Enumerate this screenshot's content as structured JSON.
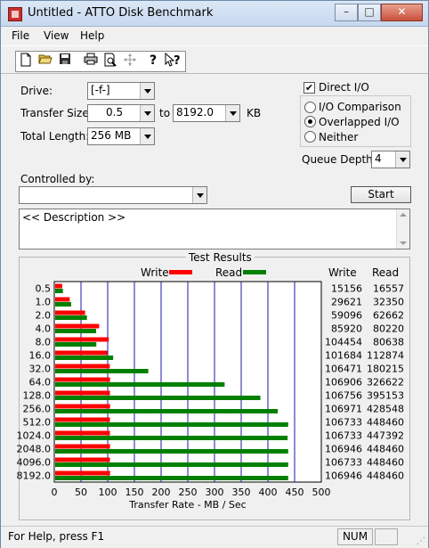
{
  "window": {
    "title": "Untitled - ATTO Disk Benchmark",
    "minimize_glyph": "–",
    "maximize_glyph": "□",
    "close_glyph": "✕"
  },
  "menu": [
    "File",
    "View",
    "Help"
  ],
  "toolbar": {
    "buttons": [
      "new-file-icon",
      "open-folder-icon",
      "save-icon",
      "print-icon",
      "print-preview-icon",
      "move-icon",
      "help-icon",
      "context-help-icon"
    ]
  },
  "form": {
    "drive_label": "Drive:",
    "drive_value": "[-f-]",
    "transfer_size_label": "Transfer Size:",
    "transfer_from": "0.5",
    "to_label": "to",
    "transfer_to": "8192.0",
    "kb_label": "KB",
    "total_length_label": "Total Length:",
    "total_length_value": "256 MB",
    "direct_io_label": "Direct I/O",
    "direct_io_checked": true,
    "io_options": [
      "I/O Comparison",
      "Overlapped I/O",
      "Neither"
    ],
    "io_selected": "Overlapped I/O",
    "queue_depth_label": "Queue Depth:",
    "queue_depth_value": "4",
    "controlled_by_label": "Controlled by:",
    "controlled_by_value": "",
    "start_label": "Start",
    "description": "<< Description >>"
  },
  "results": {
    "frame_title": "Test Results",
    "write_label": "Write",
    "read_label": "Read",
    "col_write": "Write",
    "col_read": "Read",
    "xlabel": "Transfer Rate - MB / Sec",
    "write_color": "#ff0000",
    "read_color": "#008000",
    "grid_color": "#1a1aa8"
  },
  "chart_data": {
    "type": "bar",
    "orientation": "horizontal",
    "categories": [
      "0.5",
      "1.0",
      "2.0",
      "4.0",
      "8.0",
      "16.0",
      "32.0",
      "64.0",
      "128.0",
      "256.0",
      "512.0",
      "1024.0",
      "2048.0",
      "4096.0",
      "8192.0"
    ],
    "series": [
      {
        "name": "Write",
        "values": [
          15156,
          29621,
          59096,
          85920,
          104454,
          101684,
          106471,
          106906,
          106756,
          106971,
          106733,
          106733,
          106946,
          106733,
          106946
        ],
        "color": "#ff0000"
      },
      {
        "name": "Read",
        "values": [
          16557,
          32350,
          62662,
          80220,
          80638,
          112874,
          180215,
          326622,
          395153,
          428548,
          448460,
          447392,
          448460,
          448460,
          448460
        ],
        "color": "#008000"
      }
    ],
    "xlabel": "Transfer Rate - MB / Sec",
    "x_ticks": [
      "0",
      "50",
      "100",
      "150",
      "200",
      "250",
      "300",
      "350",
      "400",
      "450",
      "500"
    ],
    "xlim": [
      0,
      500
    ],
    "grid": true,
    "legend": "top"
  },
  "status": {
    "help_text": "For Help, press F1",
    "num_indicator": "NUM"
  }
}
